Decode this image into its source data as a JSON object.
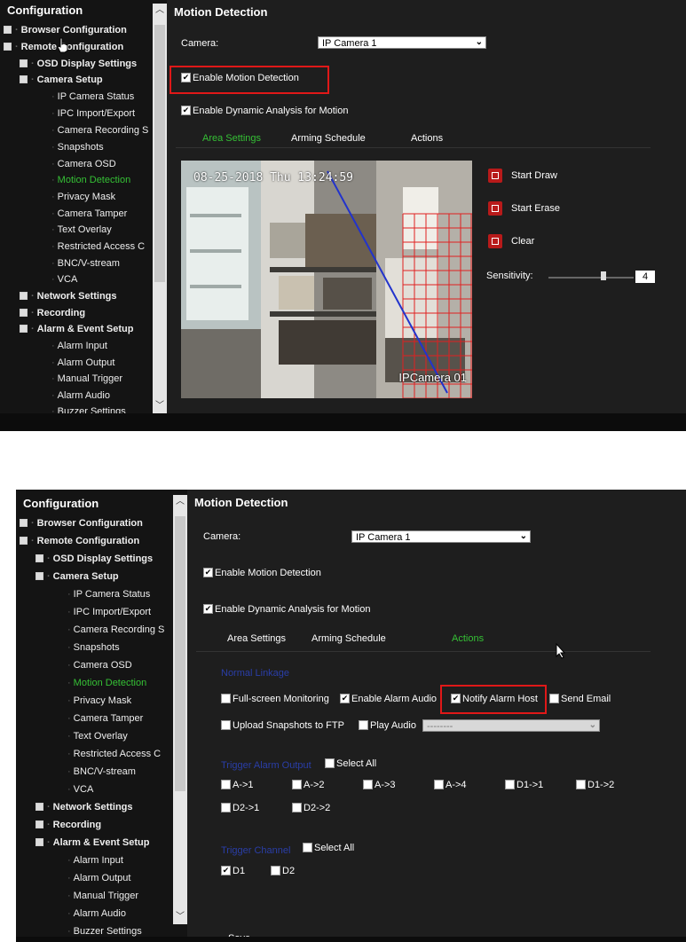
{
  "top": {
    "sidebar": {
      "heading": "Configuration",
      "items": [
        {
          "label": "Browser Configuration"
        },
        {
          "label": "Remote Configuration"
        },
        {
          "label": "OSD Display Settings"
        },
        {
          "label": "Camera Setup"
        },
        {
          "label": "IP Camera Status"
        },
        {
          "label": "IPC Import/Export"
        },
        {
          "label": "Camera Recording S"
        },
        {
          "label": "Snapshots"
        },
        {
          "label": "Camera OSD"
        },
        {
          "label": "Motion Detection"
        },
        {
          "label": "Privacy Mask"
        },
        {
          "label": "Camera Tamper"
        },
        {
          "label": "Text Overlay"
        },
        {
          "label": "Restricted Access C"
        },
        {
          "label": "BNC/V-stream"
        },
        {
          "label": "VCA"
        },
        {
          "label": "Network Settings"
        },
        {
          "label": "Recording"
        },
        {
          "label": "Alarm & Event Setup"
        },
        {
          "label": "Alarm Input"
        },
        {
          "label": "Alarm Output"
        },
        {
          "label": "Manual Trigger"
        },
        {
          "label": "Alarm Audio"
        },
        {
          "label": "Buzzer Settings"
        }
      ]
    },
    "main": {
      "title": "Motion Detection",
      "camera_label": "Camera:",
      "camera_value": "IP Camera 1",
      "enable_motion": "Enable Motion Detection",
      "enable_dynamic": "Enable Dynamic Analysis for Motion",
      "tabs": [
        "Area Settings",
        "Arming Schedule",
        "Actions"
      ],
      "video_timestamp": "08-25-2018 Thu 13:24:59",
      "video_camera_name": "IPCamera 01",
      "tools": {
        "start_draw": "Start Draw",
        "start_erase": "Start Erase",
        "clear": "Clear"
      },
      "sensitivity_label": "Sensitivity:",
      "sensitivity_value": "4"
    }
  },
  "bottom": {
    "sidebar": {
      "heading": "Configuration",
      "items": [
        {
          "label": "Browser Configuration"
        },
        {
          "label": "Remote Configuration"
        },
        {
          "label": "OSD Display Settings"
        },
        {
          "label": "Camera Setup"
        },
        {
          "label": "IP Camera Status"
        },
        {
          "label": "IPC Import/Export"
        },
        {
          "label": "Camera Recording S"
        },
        {
          "label": "Snapshots"
        },
        {
          "label": "Camera OSD"
        },
        {
          "label": "Motion Detection"
        },
        {
          "label": "Privacy Mask"
        },
        {
          "label": "Camera Tamper"
        },
        {
          "label": "Text Overlay"
        },
        {
          "label": "Restricted Access C"
        },
        {
          "label": "BNC/V-stream"
        },
        {
          "label": "VCA"
        },
        {
          "label": "Network Settings"
        },
        {
          "label": "Recording"
        },
        {
          "label": "Alarm & Event Setup"
        },
        {
          "label": "Alarm Input"
        },
        {
          "label": "Alarm Output"
        },
        {
          "label": "Manual Trigger"
        },
        {
          "label": "Alarm Audio"
        },
        {
          "label": "Buzzer Settings"
        }
      ]
    },
    "main": {
      "title": "Motion Detection",
      "camera_label": "Camera:",
      "camera_value": "IP Camera 1",
      "enable_motion": "Enable Motion Detection",
      "enable_dynamic": "Enable Dynamic Analysis for Motion",
      "tabs": [
        "Area Settings",
        "Arming Schedule",
        "Actions"
      ],
      "linkage_heading": "Normal Linkage",
      "fullscreen": "Full-screen Monitoring",
      "alarm_audio": "Enable Alarm Audio",
      "notify_host": "Notify Alarm Host",
      "send_email": "Send Email",
      "upload_ftp": "Upload Snapshots to FTP",
      "play_audio": "Play Audio",
      "play_audio_value": "--------",
      "trigger_alarm_heading": "Trigger Alarm Output",
      "select_all_1": "Select All",
      "outputs": [
        "A->1",
        "A->2",
        "A->3",
        "A->4",
        "D1->1",
        "D1->2",
        "D2->1",
        "D2->2"
      ],
      "trigger_channel_heading": "Trigger Channel",
      "select_all_2": "Select All",
      "channels": [
        "D1",
        "D2"
      ],
      "save": "Save"
    }
  },
  "colors": {
    "accent_green": "#35c035",
    "highlight_red": "#e01818",
    "panel": "#1e1e1e"
  }
}
